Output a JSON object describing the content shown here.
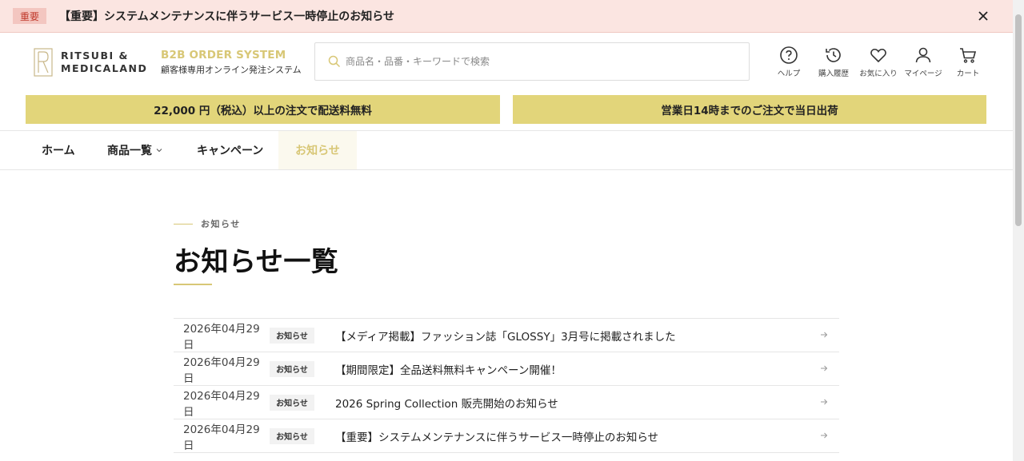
{
  "alert": {
    "badge": "重要",
    "text": "【重要】システムメンテナンスに伴うサービス一時停止のお知らせ"
  },
  "brand": {
    "line1": "RITSUBI &",
    "line2": "MEDICALAND",
    "system_title": "B2B ORDER SYSTEM",
    "system_sub": "顧客様専用オンライン発注システム"
  },
  "search": {
    "placeholder": "商品名・品番・キーワードで検索"
  },
  "header_icons": [
    {
      "label": "ヘルプ",
      "icon": "help-icon"
    },
    {
      "label": "購入履歴",
      "icon": "history-icon"
    },
    {
      "label": "お気に入り",
      "icon": "heart-icon"
    },
    {
      "label": "マイページ",
      "icon": "user-icon"
    },
    {
      "label": "カート",
      "icon": "cart-icon"
    }
  ],
  "promo": {
    "left": "22,000 円（税込）以上の注文で配送料無料",
    "right": "営業日14時までのご注文で当日出荷"
  },
  "nav": {
    "items": [
      {
        "label": "ホーム"
      },
      {
        "label": "商品一覧"
      },
      {
        "label": "キャンペーン"
      },
      {
        "label": "お知らせ"
      }
    ]
  },
  "page": {
    "eyebrow": "お知らせ",
    "title": "お知らせ一覧"
  },
  "news": [
    {
      "date": "2026年04月29日",
      "tag": "お知らせ",
      "title": "【メディア掲載】ファッション誌「GLOSSY」3月号に掲載されました"
    },
    {
      "date": "2026年04月29日",
      "tag": "お知らせ",
      "title": "【期間限定】全品送料無料キャンペーン開催！"
    },
    {
      "date": "2026年04月29日",
      "tag": "お知らせ",
      "title": "2026 Spring Collection 販売開始のお知らせ"
    },
    {
      "date": "2026年04月29日",
      "tag": "お知らせ",
      "title": "【重要】システムメンテナンスに伴うサービス一時停止のお知らせ"
    }
  ],
  "colors": {
    "accent": "#d8c776",
    "promo_bg": "#e2d57a",
    "alert_bg": "#fbe5e1",
    "alert_badge": "#c0392b"
  }
}
